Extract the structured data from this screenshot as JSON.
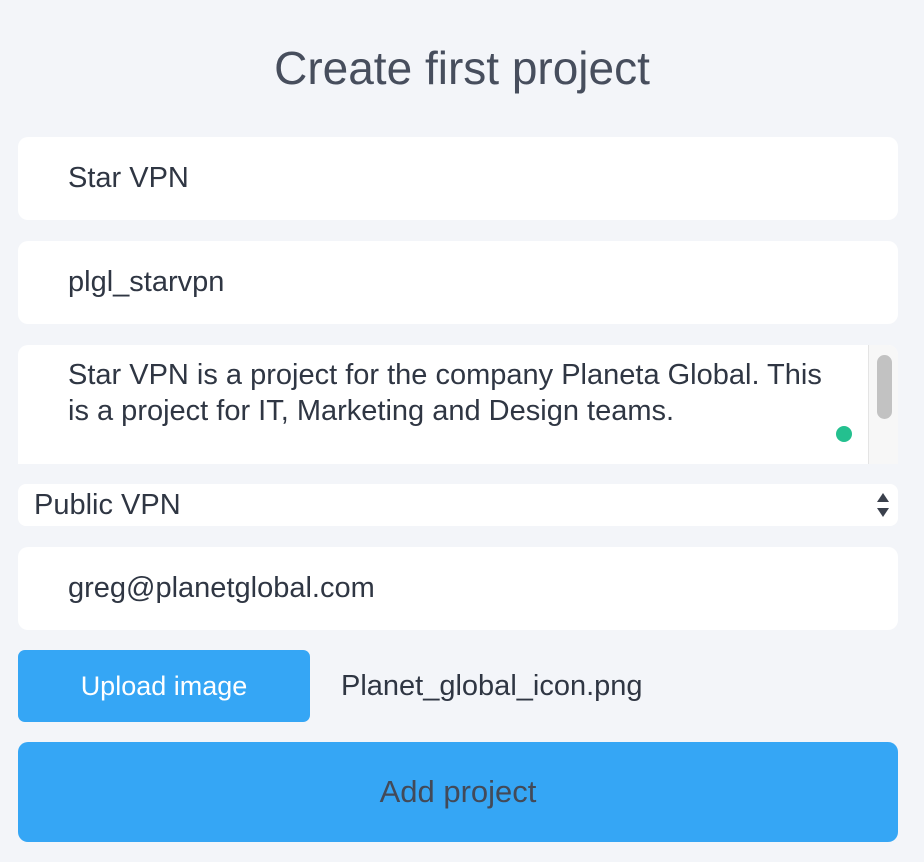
{
  "form": {
    "title": "Create first project",
    "project_name": {
      "value": "Star VPN"
    },
    "project_key": {
      "value": "plgl_starvpn"
    },
    "description": {
      "value": "Star VPN is a project for the company Planeta Global. This is a project for IT, Marketing and Design teams."
    },
    "project_type": {
      "selected": "Public VPN"
    },
    "email": {
      "value": "greg@planetglobal.com"
    },
    "upload": {
      "button_label": "Upload image",
      "file_name": "Planet_global_icon.png"
    },
    "submit_label": "Add project"
  },
  "colors": {
    "background": "#f3f5f9",
    "primary": "#35a6f5",
    "status_dot": "#24c08f"
  },
  "icons": {
    "select_arrows": "up-down-arrows-icon",
    "status": "green-dot-icon"
  }
}
